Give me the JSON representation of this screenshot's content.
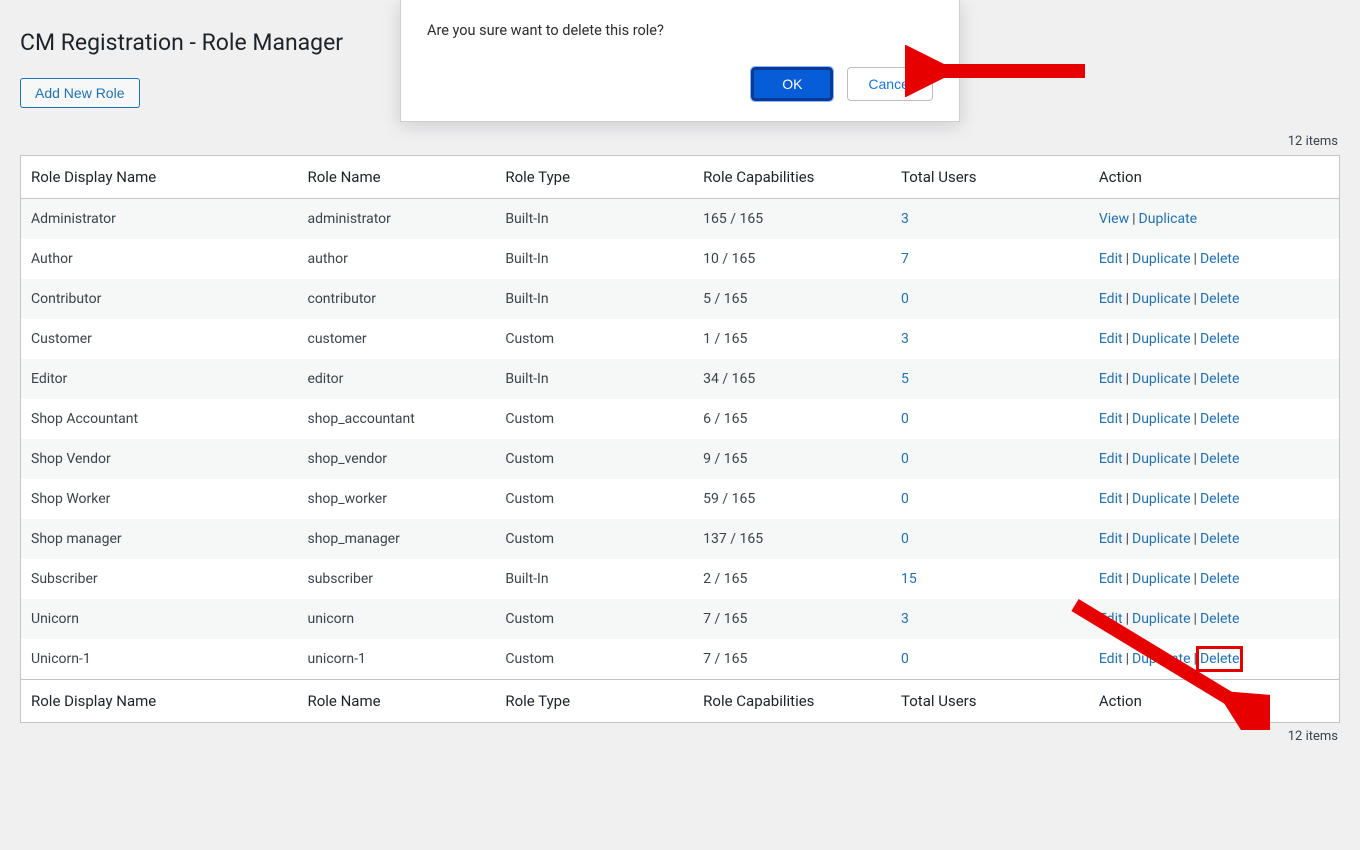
{
  "page_title": "CM Registration - Role Manager",
  "add_button": "Add New Role",
  "items_text": "12 items",
  "dialog": {
    "message": "Are you sure want to delete this role?",
    "ok": "OK",
    "cancel": "Cancel"
  },
  "columns": {
    "display": "Role Display Name",
    "name": "Role Name",
    "type": "Role Type",
    "caps": "Role Capabilities",
    "users": "Total Users",
    "action": "Action"
  },
  "actions": {
    "view": "View",
    "edit": "Edit",
    "duplicate": "Duplicate",
    "delete": "Delete"
  },
  "rows": [
    {
      "display": "Administrator",
      "name": "administrator",
      "type": "Built-In",
      "caps": "165 / 165",
      "users": "3",
      "actions": [
        "view",
        "duplicate"
      ]
    },
    {
      "display": "Author",
      "name": "author",
      "type": "Built-In",
      "caps": "10 / 165",
      "users": "7",
      "actions": [
        "edit",
        "duplicate",
        "delete"
      ]
    },
    {
      "display": "Contributor",
      "name": "contributor",
      "type": "Built-In",
      "caps": "5 / 165",
      "users": "0",
      "actions": [
        "edit",
        "duplicate",
        "delete"
      ]
    },
    {
      "display": "Customer",
      "name": "customer",
      "type": "Custom",
      "caps": "1 / 165",
      "users": "3",
      "actions": [
        "edit",
        "duplicate",
        "delete"
      ]
    },
    {
      "display": "Editor",
      "name": "editor",
      "type": "Built-In",
      "caps": "34 / 165",
      "users": "5",
      "actions": [
        "edit",
        "duplicate",
        "delete"
      ]
    },
    {
      "display": "Shop Accountant",
      "name": "shop_accountant",
      "type": "Custom",
      "caps": "6 / 165",
      "users": "0",
      "actions": [
        "edit",
        "duplicate",
        "delete"
      ]
    },
    {
      "display": "Shop Vendor",
      "name": "shop_vendor",
      "type": "Custom",
      "caps": "9 / 165",
      "users": "0",
      "actions": [
        "edit",
        "duplicate",
        "delete"
      ]
    },
    {
      "display": "Shop Worker",
      "name": "shop_worker",
      "type": "Custom",
      "caps": "59 / 165",
      "users": "0",
      "actions": [
        "edit",
        "duplicate",
        "delete"
      ]
    },
    {
      "display": "Shop manager",
      "name": "shop_manager",
      "type": "Custom",
      "caps": "137 / 165",
      "users": "0",
      "actions": [
        "edit",
        "duplicate",
        "delete"
      ]
    },
    {
      "display": "Subscriber",
      "name": "subscriber",
      "type": "Built-In",
      "caps": "2 / 165",
      "users": "15",
      "actions": [
        "edit",
        "duplicate",
        "delete"
      ]
    },
    {
      "display": "Unicorn",
      "name": "unicorn",
      "type": "Custom",
      "caps": "7 / 165",
      "users": "3",
      "actions": [
        "edit",
        "duplicate",
        "delete"
      ]
    },
    {
      "display": "Unicorn-1",
      "name": "unicorn-1",
      "type": "Custom",
      "caps": "7 / 165",
      "users": "0",
      "actions": [
        "edit",
        "duplicate",
        "delete"
      ]
    }
  ]
}
